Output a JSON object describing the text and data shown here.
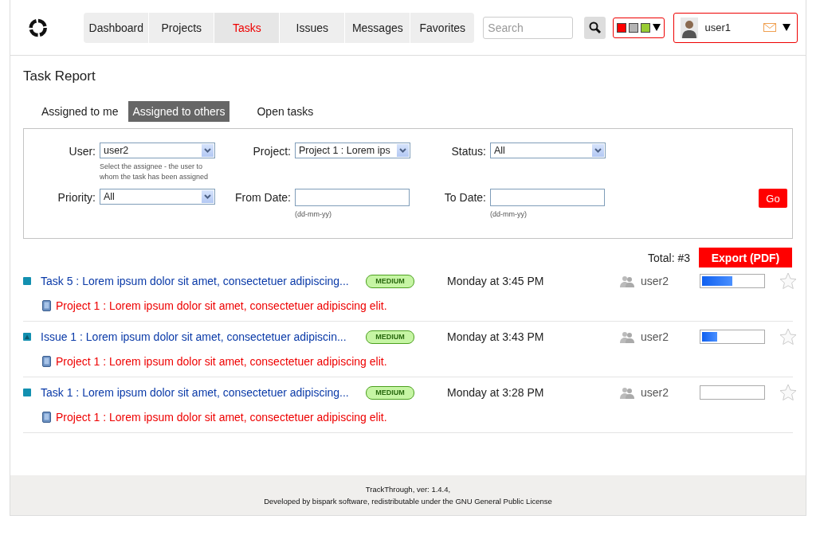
{
  "nav": [
    {
      "label": "Dashboard",
      "selected": false
    },
    {
      "label": "Projects",
      "selected": false
    },
    {
      "label": "Tasks",
      "selected": true
    },
    {
      "label": "Issues",
      "selected": false
    },
    {
      "label": "Messages",
      "selected": false
    },
    {
      "label": "Favorites",
      "selected": false
    }
  ],
  "search": {
    "placeholder": "Search"
  },
  "theme_swatches": [
    {
      "color": "#ff0000"
    },
    {
      "color": "#b4b4b4"
    },
    {
      "color": "#99cc33"
    }
  ],
  "user": {
    "name": "user1"
  },
  "page_title": "Task Report",
  "tabs": [
    {
      "label": "Assigned to me",
      "selected": false
    },
    {
      "label": "Assigned to others",
      "selected": true
    },
    {
      "label": "Open tasks",
      "selected": false
    }
  ],
  "filters": [
    {
      "kind": "select",
      "label": "User:",
      "value": "user2",
      "hint": "Select the assignee - the user to whom the task has been assigned"
    },
    {
      "kind": "select",
      "label": "Project:",
      "value": "Project 1 : Lorem ips"
    },
    {
      "kind": "select",
      "label": "Status:",
      "value": "All"
    },
    {
      "kind": "select",
      "label": "Priority:",
      "value": "All"
    },
    {
      "kind": "date",
      "label": "From Date:",
      "hint": "(dd-mm-yy)"
    },
    {
      "kind": "date",
      "label": "To Date:",
      "hint": "(dd-mm-yy)"
    }
  ],
  "go_button": "Go",
  "total": "Total: #3",
  "export_button": "Export (PDF)",
  "tasks": [
    {
      "kind": "task",
      "title": "Task 5 : Lorem ipsum dolor sit amet, consectetuer adipiscing...",
      "priority": "MEDIUM",
      "time": "Monday at 3:45 PM",
      "assignee": "user2",
      "level": 0.5,
      "favorite": false,
      "project": "Project 1 : Lorem ipsum dolor sit amet, consectetuer adipiscing elit."
    },
    {
      "kind": "issue",
      "title": "Issue 1 : Lorem ipsum dolor sit amet, consectetuer adipiscin...",
      "priority": "MEDIUM",
      "time": "Monday at 3:43 PM",
      "assignee": "user2",
      "level": 0.25,
      "favorite": false,
      "project": "Project 1 : Lorem ipsum dolor sit amet, consectetuer adipiscing elit."
    },
    {
      "kind": "task",
      "title": "Task 1 : Lorem ipsum dolor sit amet, consectetuer adipiscing...",
      "priority": "MEDIUM",
      "time": "Monday at 3:28 PM",
      "assignee": "user2",
      "level": 0,
      "favorite": false,
      "project": "Project 1 : Lorem ipsum dolor sit amet, consectetuer adipiscing elit."
    }
  ],
  "footer": [
    "TrackThrough, ver: 1.4.4,",
    "Developed by bispark software, redistributable under the GNU General Public License"
  ]
}
